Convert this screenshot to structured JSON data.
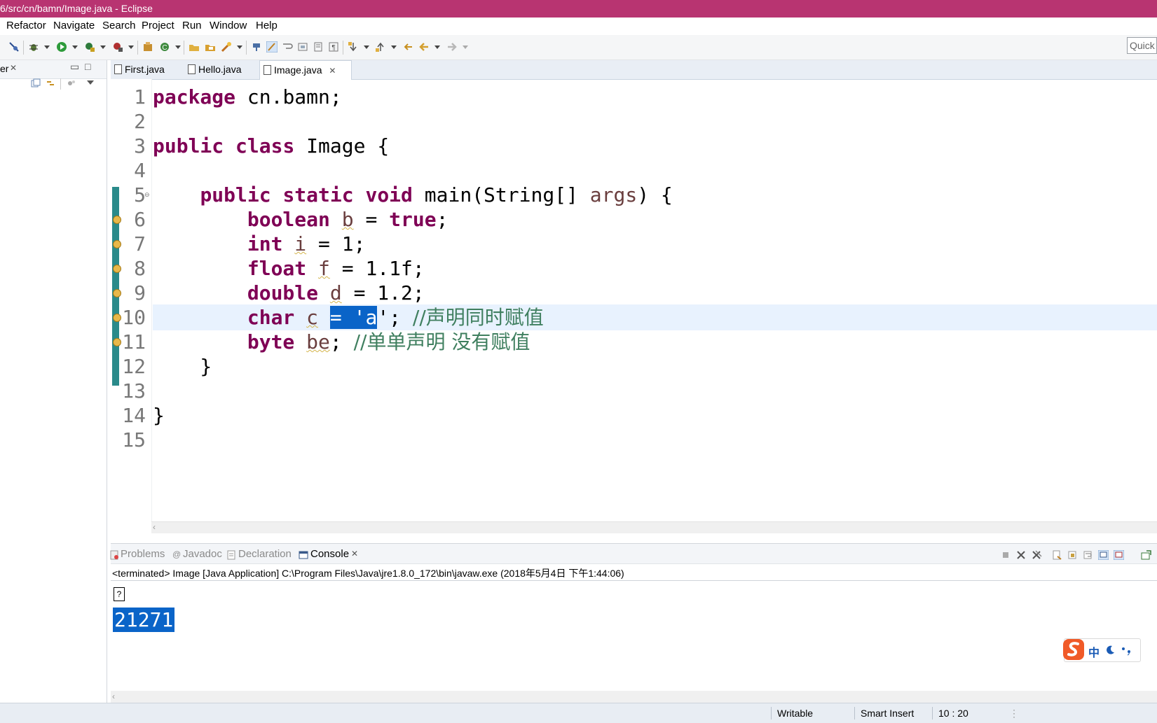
{
  "window": {
    "title": "6/src/cn/bamn/Image.java - Eclipse"
  },
  "menu": [
    "Refactor",
    "Navigate",
    "Search",
    "Project",
    "Run",
    "Window",
    "Help"
  ],
  "toolbar": {
    "quick_access_placeholder": "Quick"
  },
  "left_panel": {
    "tab_label": "er"
  },
  "editor": {
    "tabs": [
      {
        "label": "First.java",
        "active": false
      },
      {
        "label": "Hello.java",
        "active": false
      },
      {
        "label": "Image.java",
        "active": true
      }
    ],
    "line_numbers": [
      "1",
      "2",
      "3",
      "4",
      "5",
      "6",
      "7",
      "8",
      "9",
      "10",
      "11",
      "12",
      "13",
      "14",
      "15"
    ],
    "code": {
      "l1_kw": "package",
      "l1_rest": " cn.bamn;",
      "l3_kw1": "public",
      "l3_kw2": "class",
      "l3_rest": " Image {",
      "l5_indent": "    ",
      "l5_kw1": "public",
      "l5_kw2": "static",
      "l5_kw3": "void",
      "l5_mid": " main(String[] ",
      "l5_arg": "args",
      "l5_end": ") {",
      "l6_indent": "        ",
      "l6_kw": "boolean",
      "l6_var": "b",
      "l6_mid": " = ",
      "l6_val": "true",
      "l6_end": ";",
      "l7_indent": "        ",
      "l7_kw": "int",
      "l7_var": "i",
      "l7_rest": " = 1;",
      "l8_indent": "        ",
      "l8_kw": "float",
      "l8_var": "f",
      "l8_rest": " = 1.1f;",
      "l9_indent": "        ",
      "l9_kw": "double",
      "l9_var": "d",
      "l9_rest": " = 1.2;",
      "l10_indent": "        ",
      "l10_kw": "char",
      "l10_var": "c",
      "l10_sel": "= 'a",
      "l10_mid": "'; ",
      "l10_comment": "//声明同时赋值",
      "l11_indent": "        ",
      "l11_kw": "byte",
      "l11_var": "be",
      "l11_mid": "; ",
      "l11_comment": "//单单声明 没有赋值",
      "l12": "    }",
      "l14": "}"
    }
  },
  "console": {
    "tabs": [
      {
        "label": "Problems",
        "active": false
      },
      {
        "label": "Javadoc",
        "active": false
      },
      {
        "label": "Declaration",
        "active": false
      },
      {
        "label": "Console",
        "active": true
      }
    ],
    "info": "<terminated> Image [Java Application] C:\\Program Files\\Java\\jre1.8.0_172\\bin\\javaw.exe (2018年5月4日 下午1:44:06)",
    "output_line1": "?",
    "output_line2": "21271"
  },
  "ime": {
    "label": "中"
  },
  "status": {
    "writable": "Writable",
    "insert_mode": "Smart Insert",
    "position": "10 : 20"
  },
  "colors": {
    "title_bar": "#b83471",
    "keyword": "#7f0055",
    "comment": "#3f7f5f",
    "selection": "#0a64c8"
  }
}
